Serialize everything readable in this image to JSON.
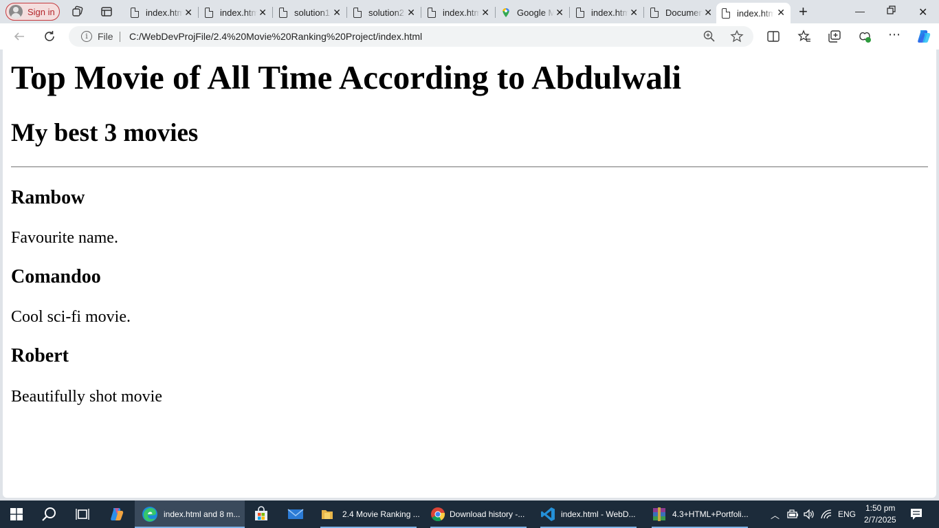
{
  "browser": {
    "signin_label": "Sign in",
    "tabs": [
      {
        "title": "index.html",
        "icon": "page-icon"
      },
      {
        "title": "index.html",
        "icon": "page-icon"
      },
      {
        "title": "solution1",
        "icon": "page-icon"
      },
      {
        "title": "solution2",
        "icon": "page-icon"
      },
      {
        "title": "index.html",
        "icon": "page-icon"
      },
      {
        "title": "Google Maps",
        "icon": "maps-pin-icon"
      },
      {
        "title": "index.html",
        "icon": "page-icon"
      },
      {
        "title": "Document",
        "icon": "page-icon"
      },
      {
        "title": "index.html",
        "icon": "page-icon",
        "active": true
      }
    ],
    "address": {
      "scheme_label": "File",
      "url": "C:/WebDevProjFile/2.4%20Movie%20Ranking%20Project/index.html"
    }
  },
  "page": {
    "h1": "Top Movie of All Time According to Abdulwali",
    "h2": "My best 3 movies",
    "movies": [
      {
        "title": "Rambow",
        "description": "Favourite name."
      },
      {
        "title": "Comandoo",
        "description": "Cool sci-fi movie."
      },
      {
        "title": "Robert",
        "description": "Beautifully shot movie"
      }
    ]
  },
  "taskbar": {
    "items": [
      {
        "label": "index.html and 8 m...",
        "icon": "edge-icon",
        "active": true
      },
      {
        "label": "",
        "icon": "store-icon"
      },
      {
        "label": "",
        "icon": "mail-icon"
      },
      {
        "label": "2.4 Movie Ranking ...",
        "icon": "folder-icon"
      },
      {
        "label": "Download history -...",
        "icon": "chrome-icon"
      },
      {
        "label": "index.html - WebD...",
        "icon": "vscode-icon"
      },
      {
        "label": "4.3+HTML+Portfoli...",
        "icon": "winrar-icon"
      }
    ],
    "tray": {
      "language": "ENG",
      "time": "1:50 pm",
      "date": "2/7/2025"
    }
  },
  "colors": {
    "tab_strip": "#dfe3e8",
    "taskbar": "#1c2b3a",
    "accent": "#0078d4"
  }
}
